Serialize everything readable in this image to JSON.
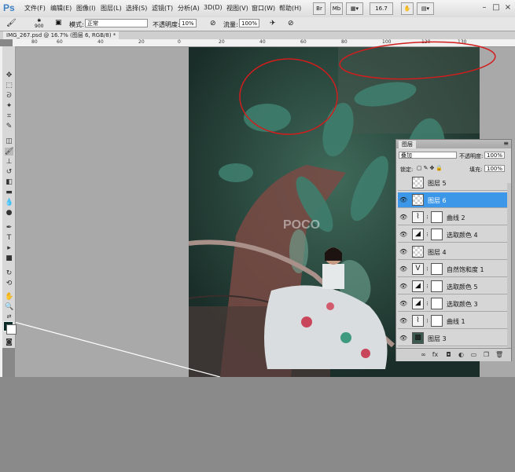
{
  "app": {
    "logo": "Ps"
  },
  "menu": [
    "文件(F)",
    "编辑(E)",
    "图像(I)",
    "图层(L)",
    "选择(S)",
    "滤镜(T)",
    "分析(A)",
    "3D(D)",
    "视图(V)",
    "窗口(W)",
    "帮助(H)"
  ],
  "toolbar_top": {
    "br": "Br",
    "mb": "Mb",
    "zoom": "16.7"
  },
  "options": {
    "brush_size": "900",
    "mode_label": "模式:",
    "mode_value": "正常",
    "opacity_label": "不透明度:",
    "opacity_value": "10%",
    "flow_label": "流量:",
    "flow_value": "100%"
  },
  "document": {
    "tab": "IMG_267.psd @ 16.7% (图层 6, RGB/8) *"
  },
  "ruler_h": [
    "80",
    "60",
    "40",
    "20",
    "0",
    "20",
    "40",
    "60",
    "80",
    "100",
    "120",
    "130"
  ],
  "layers_panel": {
    "tab": "图层",
    "blend_mode": "叠加",
    "opacity_label": "不透明度:",
    "opacity_value": "100%",
    "lock_label": "锁定:",
    "fill_label": "填充:",
    "fill_value": "100%",
    "layers": [
      {
        "name": "图层 5",
        "visible": false,
        "thumb": "checker",
        "mask": false,
        "selected": false
      },
      {
        "name": "图层 6",
        "visible": true,
        "thumb": "checker",
        "mask": false,
        "selected": true
      },
      {
        "name": "曲线 2",
        "visible": true,
        "thumb": "curves",
        "mask": true,
        "selected": false
      },
      {
        "name": "选取颜色 4",
        "visible": true,
        "thumb": "selective",
        "mask": true,
        "selected": false
      },
      {
        "name": "图层 4",
        "visible": true,
        "thumb": "checker",
        "mask": false,
        "selected": false
      },
      {
        "name": "自然饱和度 1",
        "visible": true,
        "thumb": "vibrance",
        "mask": true,
        "selected": false
      },
      {
        "name": "选取颜色 5",
        "visible": true,
        "thumb": "selective",
        "mask": true,
        "selected": false
      },
      {
        "name": "选取颜色 3",
        "visible": true,
        "thumb": "selective",
        "mask": true,
        "selected": false
      },
      {
        "name": "曲线 1",
        "visible": true,
        "thumb": "curves",
        "mask": true,
        "selected": false
      },
      {
        "name": "图层 3",
        "visible": true,
        "thumb": "photo",
        "mask": false,
        "selected": false
      }
    ]
  },
  "watermark": "POCO",
  "colors": {
    "foreground": "#0a2a28",
    "background": "#ffffff",
    "selection": "#3c97e8",
    "annotation": "#d21d1d"
  }
}
